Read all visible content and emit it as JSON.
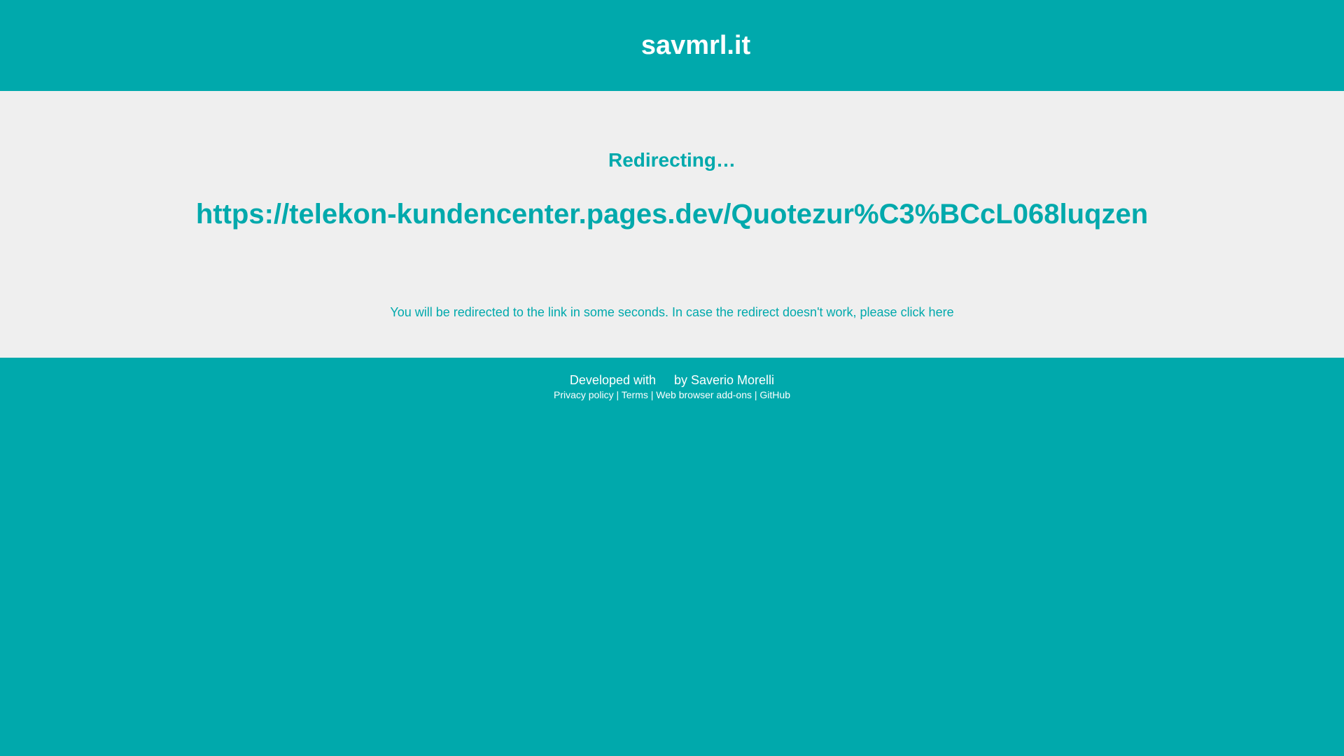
{
  "header": {
    "title": "savmrl.it"
  },
  "main": {
    "heading": "Redirecting…",
    "target_url": "https://telekon-kundencenter.pages.dev/Quotezur%C3%BCcL068luqzen",
    "notice_text": "You will be redirected to the link in some seconds. In case the redirect doesn't work, please ",
    "notice_link": "click here"
  },
  "footer": {
    "developed_with": "Developed with",
    "by_prefix": "by ",
    "author": "Saverio Morelli",
    "links": {
      "privacy": "Privacy policy",
      "terms": "Terms",
      "addons": "Web browser add-ons",
      "github": "GitHub"
    },
    "separator": "|"
  },
  "colors": {
    "accent": "#00a9ac",
    "content_background": "#efefef",
    "text_light": "#ffffff"
  }
}
